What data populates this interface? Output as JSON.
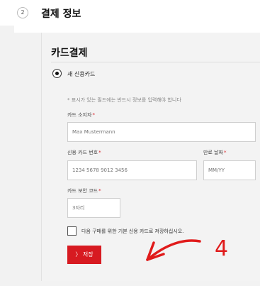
{
  "section": {
    "step_number": "2",
    "title": "결제 정보"
  },
  "payment": {
    "title": "카드결제",
    "option_new_card": "새 신용카드",
    "required_notice": "* 표시가 있는 필드에는 반드시 정보를 입력해야 합니다",
    "cardholder": {
      "label": "카드 소지자",
      "placeholder": "Max Mustermann"
    },
    "card_number": {
      "label": "신용 카드 번호",
      "placeholder": "1234 5678 9012 3456"
    },
    "expiry": {
      "label": "만료 날짜",
      "placeholder": "MM/YY"
    },
    "cvc": {
      "label": "카드 보안 코드",
      "placeholder": "3자리"
    },
    "required_mark": "*",
    "save_card_label": "다음 구매를 위한 기본 신용 카드로 저장하십시오.",
    "save_button": "〉 저장"
  },
  "annotation": {
    "number": "4",
    "color": "#e01b1b"
  },
  "colors": {
    "accent": "#d71a21"
  }
}
